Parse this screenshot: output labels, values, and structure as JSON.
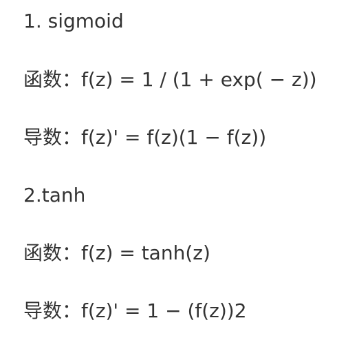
{
  "sections": [
    {
      "heading": "1. sigmoid",
      "function": {
        "label": "函数",
        "separator": "：",
        "formula": "f(z) = 1 / (1 + exp( − z))"
      },
      "derivative": {
        "label": "导数",
        "separator": "：",
        "formula": "f(z)' = f(z)(1 − f(z))"
      }
    },
    {
      "heading": "2.tanh",
      "function": {
        "label": "函数",
        "separator": "：",
        "formula": "f(z) = tanh(z)"
      },
      "derivative": {
        "label": "导数",
        "separator": "：",
        "formula": "f(z)' = 1 − (f(z))2"
      }
    }
  ]
}
